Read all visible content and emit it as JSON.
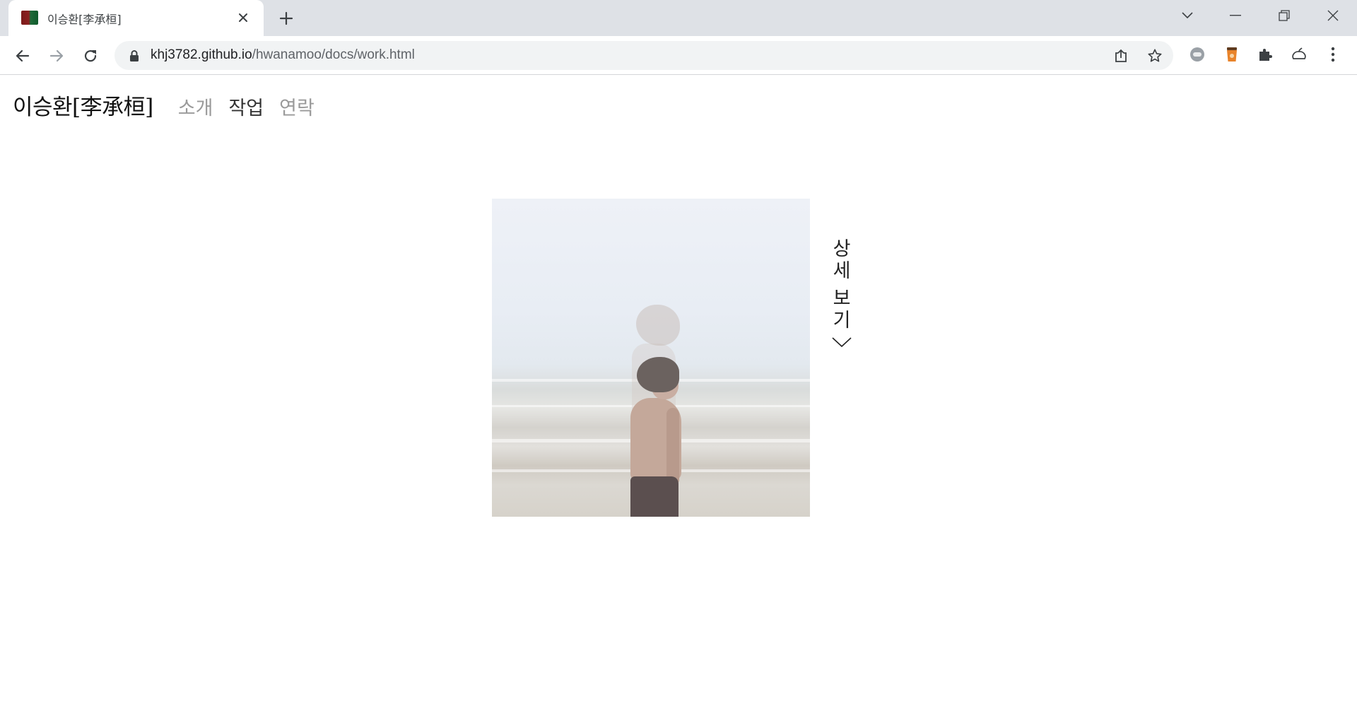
{
  "browser": {
    "tab_title": "이승환[李承桓]",
    "url_host": "khj3782.github.io",
    "url_path": "/hwanamoo/docs/work.html"
  },
  "site": {
    "title": "이승환[李承桓]",
    "nav": [
      {
        "label": "소개",
        "state": "muted"
      },
      {
        "label": "작업",
        "state": "active"
      },
      {
        "label": "연락",
        "state": "muted"
      }
    ],
    "detail_chars": [
      "상",
      "세",
      "보",
      "기"
    ]
  },
  "icons": {
    "chevron": "chevron-down-icon"
  },
  "colors": {
    "chrome_bg": "#dee1e6",
    "omnibox_bg": "#f1f3f4",
    "nav_active": "#333333",
    "nav_muted": "#9a9a9a"
  }
}
